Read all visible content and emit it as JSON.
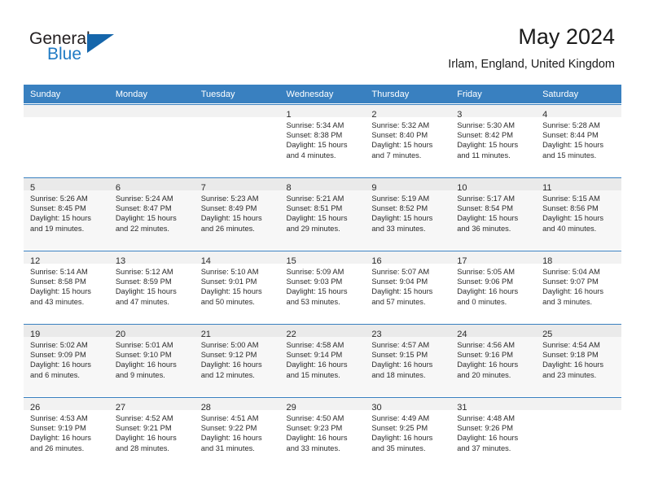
{
  "brand": {
    "name_part1": "General",
    "name_part2": "Blue",
    "triangle_color": "#1566ab",
    "blue_color": "#1f7ac4"
  },
  "header": {
    "month_title": "May 2024",
    "location": "Irlam, England, United Kingdom",
    "header_bg": "#3980c0"
  },
  "weekday_headers": [
    "Sunday",
    "Monday",
    "Tuesday",
    "Wednesday",
    "Thursday",
    "Friday",
    "Saturday"
  ],
  "weeks": [
    [
      {
        "day": "",
        "lines": [
          "",
          "",
          "",
          ""
        ]
      },
      {
        "day": "",
        "lines": [
          "",
          "",
          "",
          ""
        ]
      },
      {
        "day": "",
        "lines": [
          "",
          "",
          "",
          ""
        ]
      },
      {
        "day": "1",
        "lines": [
          "Sunrise: 5:34 AM",
          "Sunset: 8:38 PM",
          "Daylight: 15 hours",
          "and 4 minutes."
        ]
      },
      {
        "day": "2",
        "lines": [
          "Sunrise: 5:32 AM",
          "Sunset: 8:40 PM",
          "Daylight: 15 hours",
          "and 7 minutes."
        ]
      },
      {
        "day": "3",
        "lines": [
          "Sunrise: 5:30 AM",
          "Sunset: 8:42 PM",
          "Daylight: 15 hours",
          "and 11 minutes."
        ]
      },
      {
        "day": "4",
        "lines": [
          "Sunrise: 5:28 AM",
          "Sunset: 8:44 PM",
          "Daylight: 15 hours",
          "and 15 minutes."
        ]
      }
    ],
    [
      {
        "day": "5",
        "lines": [
          "Sunrise: 5:26 AM",
          "Sunset: 8:45 PM",
          "Daylight: 15 hours",
          "and 19 minutes."
        ]
      },
      {
        "day": "6",
        "lines": [
          "Sunrise: 5:24 AM",
          "Sunset: 8:47 PM",
          "Daylight: 15 hours",
          "and 22 minutes."
        ]
      },
      {
        "day": "7",
        "lines": [
          "Sunrise: 5:23 AM",
          "Sunset: 8:49 PM",
          "Daylight: 15 hours",
          "and 26 minutes."
        ]
      },
      {
        "day": "8",
        "lines": [
          "Sunrise: 5:21 AM",
          "Sunset: 8:51 PM",
          "Daylight: 15 hours",
          "and 29 minutes."
        ]
      },
      {
        "day": "9",
        "lines": [
          "Sunrise: 5:19 AM",
          "Sunset: 8:52 PM",
          "Daylight: 15 hours",
          "and 33 minutes."
        ]
      },
      {
        "day": "10",
        "lines": [
          "Sunrise: 5:17 AM",
          "Sunset: 8:54 PM",
          "Daylight: 15 hours",
          "and 36 minutes."
        ]
      },
      {
        "day": "11",
        "lines": [
          "Sunrise: 5:15 AM",
          "Sunset: 8:56 PM",
          "Daylight: 15 hours",
          "and 40 minutes."
        ]
      }
    ],
    [
      {
        "day": "12",
        "lines": [
          "Sunrise: 5:14 AM",
          "Sunset: 8:58 PM",
          "Daylight: 15 hours",
          "and 43 minutes."
        ]
      },
      {
        "day": "13",
        "lines": [
          "Sunrise: 5:12 AM",
          "Sunset: 8:59 PM",
          "Daylight: 15 hours",
          "and 47 minutes."
        ]
      },
      {
        "day": "14",
        "lines": [
          "Sunrise: 5:10 AM",
          "Sunset: 9:01 PM",
          "Daylight: 15 hours",
          "and 50 minutes."
        ]
      },
      {
        "day": "15",
        "lines": [
          "Sunrise: 5:09 AM",
          "Sunset: 9:03 PM",
          "Daylight: 15 hours",
          "and 53 minutes."
        ]
      },
      {
        "day": "16",
        "lines": [
          "Sunrise: 5:07 AM",
          "Sunset: 9:04 PM",
          "Daylight: 15 hours",
          "and 57 minutes."
        ]
      },
      {
        "day": "17",
        "lines": [
          "Sunrise: 5:05 AM",
          "Sunset: 9:06 PM",
          "Daylight: 16 hours",
          "and 0 minutes."
        ]
      },
      {
        "day": "18",
        "lines": [
          "Sunrise: 5:04 AM",
          "Sunset: 9:07 PM",
          "Daylight: 16 hours",
          "and 3 minutes."
        ]
      }
    ],
    [
      {
        "day": "19",
        "lines": [
          "Sunrise: 5:02 AM",
          "Sunset: 9:09 PM",
          "Daylight: 16 hours",
          "and 6 minutes."
        ]
      },
      {
        "day": "20",
        "lines": [
          "Sunrise: 5:01 AM",
          "Sunset: 9:10 PM",
          "Daylight: 16 hours",
          "and 9 minutes."
        ]
      },
      {
        "day": "21",
        "lines": [
          "Sunrise: 5:00 AM",
          "Sunset: 9:12 PM",
          "Daylight: 16 hours",
          "and 12 minutes."
        ]
      },
      {
        "day": "22",
        "lines": [
          "Sunrise: 4:58 AM",
          "Sunset: 9:14 PM",
          "Daylight: 16 hours",
          "and 15 minutes."
        ]
      },
      {
        "day": "23",
        "lines": [
          "Sunrise: 4:57 AM",
          "Sunset: 9:15 PM",
          "Daylight: 16 hours",
          "and 18 minutes."
        ]
      },
      {
        "day": "24",
        "lines": [
          "Sunrise: 4:56 AM",
          "Sunset: 9:16 PM",
          "Daylight: 16 hours",
          "and 20 minutes."
        ]
      },
      {
        "day": "25",
        "lines": [
          "Sunrise: 4:54 AM",
          "Sunset: 9:18 PM",
          "Daylight: 16 hours",
          "and 23 minutes."
        ]
      }
    ],
    [
      {
        "day": "26",
        "lines": [
          "Sunrise: 4:53 AM",
          "Sunset: 9:19 PM",
          "Daylight: 16 hours",
          "and 26 minutes."
        ]
      },
      {
        "day": "27",
        "lines": [
          "Sunrise: 4:52 AM",
          "Sunset: 9:21 PM",
          "Daylight: 16 hours",
          "and 28 minutes."
        ]
      },
      {
        "day": "28",
        "lines": [
          "Sunrise: 4:51 AM",
          "Sunset: 9:22 PM",
          "Daylight: 16 hours",
          "and 31 minutes."
        ]
      },
      {
        "day": "29",
        "lines": [
          "Sunrise: 4:50 AM",
          "Sunset: 9:23 PM",
          "Daylight: 16 hours",
          "and 33 minutes."
        ]
      },
      {
        "day": "30",
        "lines": [
          "Sunrise: 4:49 AM",
          "Sunset: 9:25 PM",
          "Daylight: 16 hours",
          "and 35 minutes."
        ]
      },
      {
        "day": "31",
        "lines": [
          "Sunrise: 4:48 AM",
          "Sunset: 9:26 PM",
          "Daylight: 16 hours",
          "and 37 minutes."
        ]
      },
      {
        "day": "",
        "lines": [
          "",
          "",
          "",
          ""
        ]
      }
    ]
  ]
}
